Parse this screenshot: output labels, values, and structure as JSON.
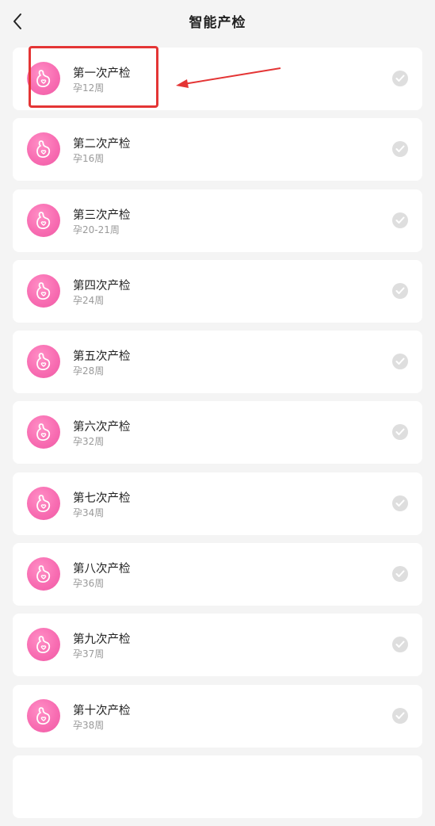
{
  "header": {
    "title": "智能产检"
  },
  "visits": [
    {
      "title": "第一次产检",
      "week": "孕12周"
    },
    {
      "title": "第二次产检",
      "week": "孕16周"
    },
    {
      "title": "第三次产检",
      "week": "孕20-21周"
    },
    {
      "title": "第四次产检",
      "week": "孕24周"
    },
    {
      "title": "第五次产检",
      "week": "孕28周"
    },
    {
      "title": "第六次产检",
      "week": "孕32周"
    },
    {
      "title": "第七次产检",
      "week": "孕34周"
    },
    {
      "title": "第八次产检",
      "week": "孕36周"
    },
    {
      "title": "第九次产检",
      "week": "孕37周"
    },
    {
      "title": "第十次产检",
      "week": "孕38周"
    }
  ],
  "icons": {
    "back": "chevron-left-icon",
    "avatar": "pregnant-belly-heart-icon",
    "status": "check-circle-icon"
  },
  "colors": {
    "background": "#f4f4f4",
    "card": "#ffffff",
    "avatar_pink": "#f86db2",
    "check_gray": "#dedede",
    "annotation_red": "#e43535"
  }
}
